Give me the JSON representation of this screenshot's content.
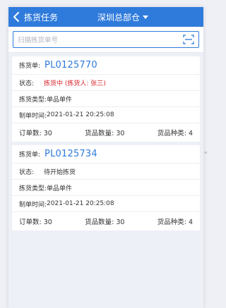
{
  "header": {
    "title": "拣货任务",
    "warehouse": "深圳总部仓"
  },
  "search": {
    "placeholder": "扫描拣货单号"
  },
  "tasks": [
    {
      "no_label": "拣货单:",
      "no": "PL0125770",
      "status_label": "状态:",
      "status": "拣货中 (拣货人: 张三)",
      "status_color": "#d9262c",
      "type_label": "拣货类型:",
      "type": "单品单件",
      "created_label": "制单时间:",
      "created": "2021-01-21 20:25:08",
      "orders_label": "订单数:",
      "orders": "30",
      "qty_label": "货品数量:",
      "qty": "30",
      "kinds_label": "货品种类:",
      "kinds": "4"
    },
    {
      "no_label": "拣货单:",
      "no": "PL0125734",
      "status_label": "状态:",
      "status": "待开始拣货",
      "status_color": "#333333",
      "type_label": "拣货类型:",
      "type": "单品单件",
      "created_label": "制单时间:",
      "created": "2021-01-21 20:25:08",
      "orders_label": "订单数:",
      "orders": "30",
      "qty_label": "货品数量:",
      "qty": "30",
      "kinds_label": "货品种类:",
      "kinds": "4"
    }
  ],
  "icons": {
    "back": "chevron-left-icon",
    "dropdown": "caret-down-icon",
    "scan": "scan-icon"
  },
  "colors": {
    "primary": "#2f7bdc",
    "danger": "#d9262c"
  }
}
